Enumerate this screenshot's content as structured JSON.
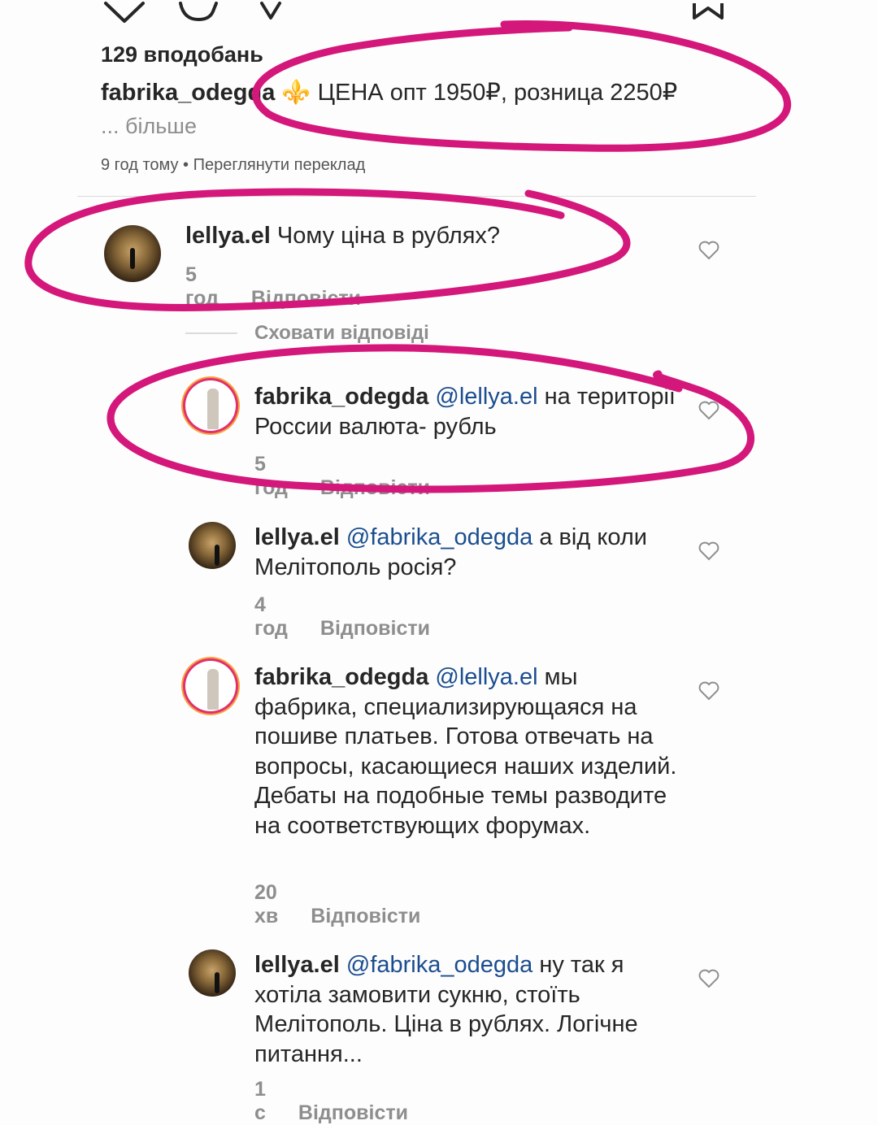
{
  "post": {
    "likes": "129 вподобань",
    "caption_user": "fabrika_odegda",
    "caption_text": "⚜️ ЦЕНА опт 1950₽, розница 2250₽",
    "more": "... більше",
    "meta": "9 год тому • Переглянути переклад"
  },
  "hide_replies": "Сховати відповіді",
  "comments": [
    {
      "user": "lellya.el",
      "mention": "",
      "text": "Чому ціна в рублях?",
      "time": "5 год",
      "reply": "Відповісти"
    },
    {
      "user": "fabrika_odegda",
      "mention": "@lellya.el",
      "text": "на території России валюта- рубль",
      "time": "5 год",
      "reply": "Відповісти"
    },
    {
      "user": "lellya.el",
      "mention": "@fabrika_odegda",
      "text": "а від коли Мелітополь росія?",
      "time": "4 год",
      "reply": "Відповісти"
    },
    {
      "user": "fabrika_odegda",
      "mention": "@lellya.el",
      "text": "мы фабрика, специализирующаяся на пошиве платьев. Готова отвечать на вопросы, касающиеся наших изделий. Дебаты на подобные темы разводите на соответствующих форумах.",
      "time": "20 хв",
      "reply": "Відповісти"
    },
    {
      "user": "lellya.el",
      "mention": "@fabrika_odegda",
      "text": "ну так я хотіла замовити сукню, стоїть Мелітополь. Ціна в рублях. Логічне питання...",
      "time": "1 с",
      "reply": "Відповісти"
    }
  ],
  "colors": {
    "annotation": "#d4177a",
    "mention": "#1a4d8f"
  },
  "icons": [
    "heart-icon",
    "comment-icon",
    "share-icon",
    "bookmark-icon"
  ]
}
